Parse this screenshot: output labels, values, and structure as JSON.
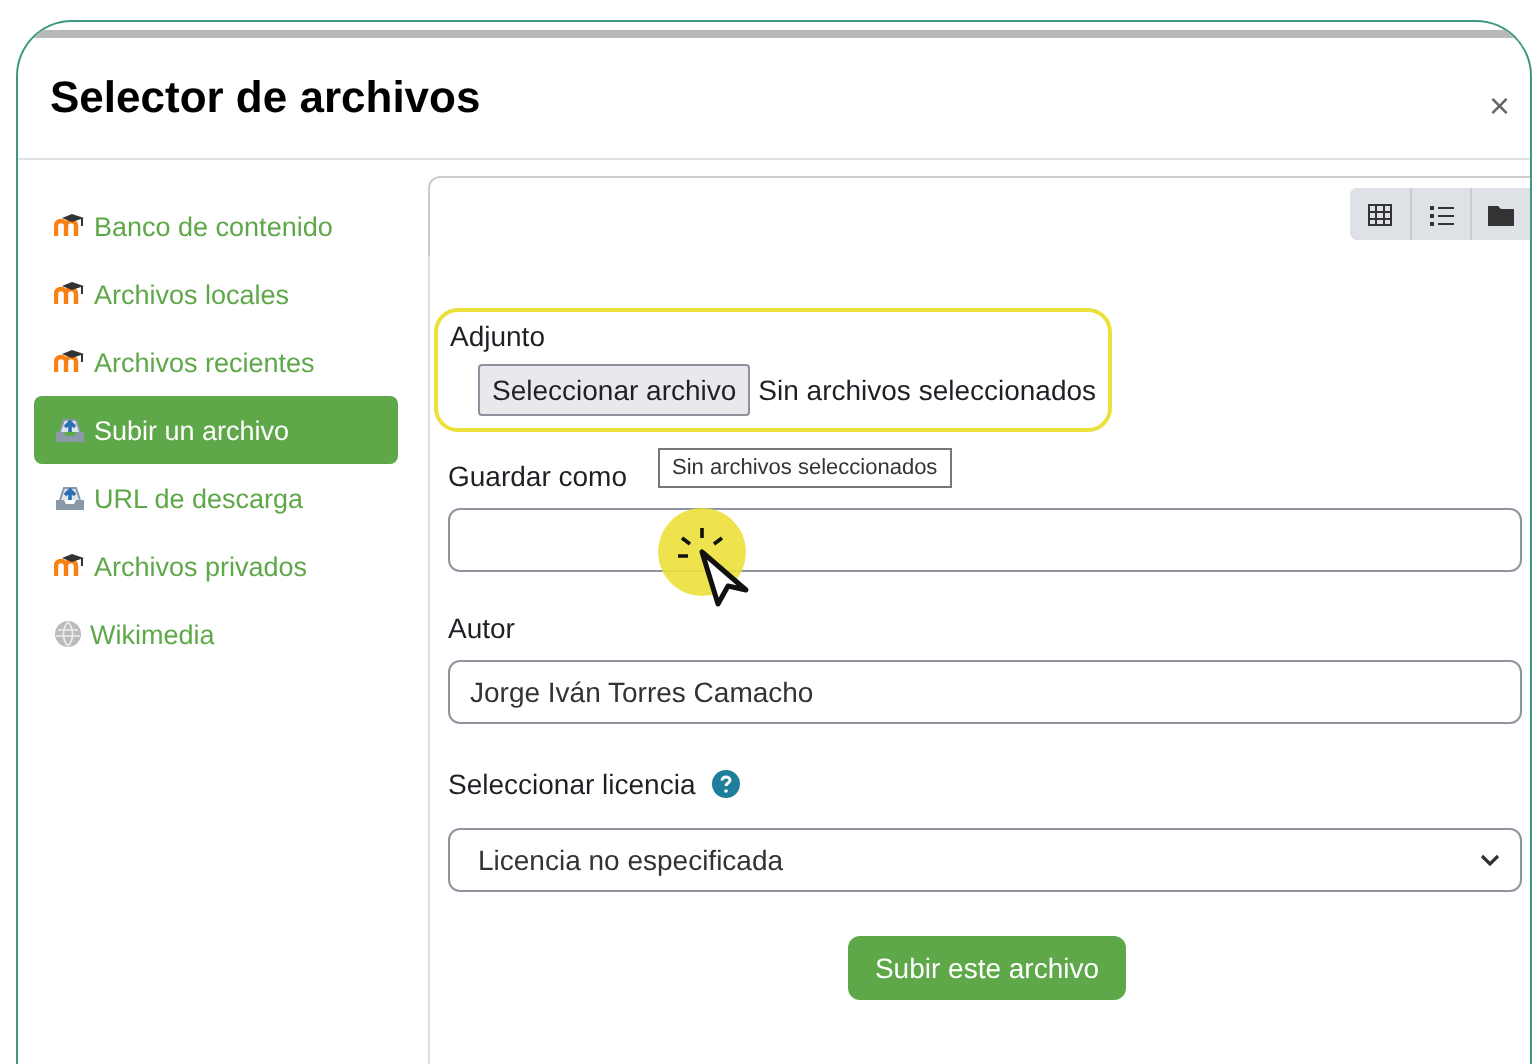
{
  "dialog": {
    "title": "Selector de archivos",
    "close": "×"
  },
  "sidebar": {
    "items": [
      {
        "label": "Banco de contenido",
        "kind": "moodle",
        "selected": false
      },
      {
        "label": "Archivos locales",
        "kind": "moodle",
        "selected": false
      },
      {
        "label": "Archivos recientes",
        "kind": "moodle",
        "selected": false
      },
      {
        "label": "Subir un archivo",
        "kind": "upload",
        "selected": true
      },
      {
        "label": "URL de descarga",
        "kind": "upload",
        "selected": false
      },
      {
        "label": "Archivos privados",
        "kind": "moodle",
        "selected": false
      },
      {
        "label": "Wikimedia",
        "kind": "globe",
        "selected": false
      }
    ]
  },
  "view_buttons": [
    {
      "kind": "grid"
    },
    {
      "kind": "list"
    },
    {
      "kind": "folder"
    }
  ],
  "form": {
    "attachment": {
      "label": "Adjunto",
      "button": "Seleccionar archivo",
      "status": "Sin archivos seleccionados",
      "highlighted": true
    },
    "tooltip": "Sin archivos seleccionados",
    "save_as": {
      "label": "Guardar como"
    },
    "author": {
      "label": "Autor",
      "value": "Jorge Iván Torres Camacho"
    },
    "license": {
      "label": "Seleccionar licencia",
      "value": "Licencia no especificada"
    },
    "submit": "Subir este archivo"
  }
}
